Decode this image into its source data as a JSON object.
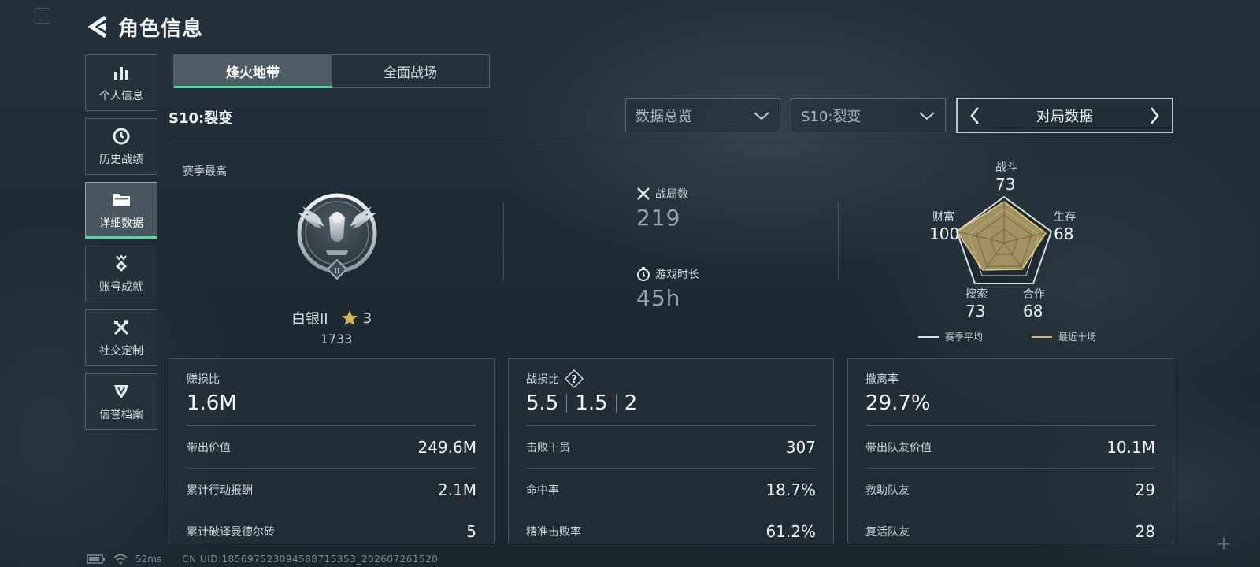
{
  "header": {
    "title": "角色信息"
  },
  "sidebar": {
    "items": [
      {
        "label": "个人信息",
        "icon": "bar-chart-icon"
      },
      {
        "label": "历史战绩",
        "icon": "clock-icon"
      },
      {
        "label": "详细数据",
        "icon": "folder-icon",
        "active": true
      },
      {
        "label": "账号成就",
        "icon": "medal-icon"
      },
      {
        "label": "社交定制",
        "icon": "tools-icon"
      },
      {
        "label": "信誉档案",
        "icon": "shield-icon"
      }
    ]
  },
  "mode_tabs": [
    {
      "label": "烽火地带",
      "active": true
    },
    {
      "label": "全面战场",
      "active": false
    }
  ],
  "season": {
    "title": "S10:裂变"
  },
  "filters": {
    "category": "数据总览",
    "season": "S10:裂变",
    "pager_label": "对局数据"
  },
  "rank": {
    "section_label": "赛季最高",
    "name": "白银II",
    "stars": "3",
    "score": "1733",
    "badge_tier": "II"
  },
  "stats": {
    "matches_label": "战局数",
    "matches_value": "219",
    "playtime_label": "游戏时长",
    "playtime_value": "45h"
  },
  "radar": {
    "axes": [
      {
        "label": "战斗",
        "value": "73"
      },
      {
        "label": "生存",
        "value": "68"
      },
      {
        "label": "合作",
        "value": "68"
      },
      {
        "label": "搜索",
        "value": "73"
      },
      {
        "label": "财富",
        "value": "100"
      }
    ],
    "legend": [
      {
        "label": "赛季平均",
        "color": "#d9dee1"
      },
      {
        "label": "最近十场",
        "color": "#d6b35a"
      }
    ],
    "fill_color": "#b8a46a"
  },
  "cards": {
    "profit": {
      "title": "赚损比",
      "value": "1.6M",
      "rows": [
        {
          "key": "带出价值",
          "value": "249.6M"
        },
        {
          "key": "累计行动报酬",
          "value": "2.1M"
        },
        {
          "key": "累计破译曼德尔砖",
          "value": "5"
        }
      ]
    },
    "combat": {
      "title": "战损比",
      "values": [
        "5.5",
        "1.5",
        "2"
      ],
      "rows": [
        {
          "key": "击败干员",
          "value": "307"
        },
        {
          "key": "命中率",
          "value": "18.7%"
        },
        {
          "key": "精准击败率",
          "value": "61.2%"
        }
      ]
    },
    "extract": {
      "title": "撤离率",
      "value": "29.7%",
      "rows": [
        {
          "key": "带出队友价值",
          "value": "10.1M"
        },
        {
          "key": "救助队友",
          "value": "29"
        },
        {
          "key": "复活队友",
          "value": "28"
        }
      ]
    }
  },
  "status_bar": {
    "ping": "52ms",
    "uid": "CN UID:18569752309458871535​3_202607261520"
  },
  "colors": {
    "accent": "#45e09a",
    "gold": "#d6b35a"
  }
}
